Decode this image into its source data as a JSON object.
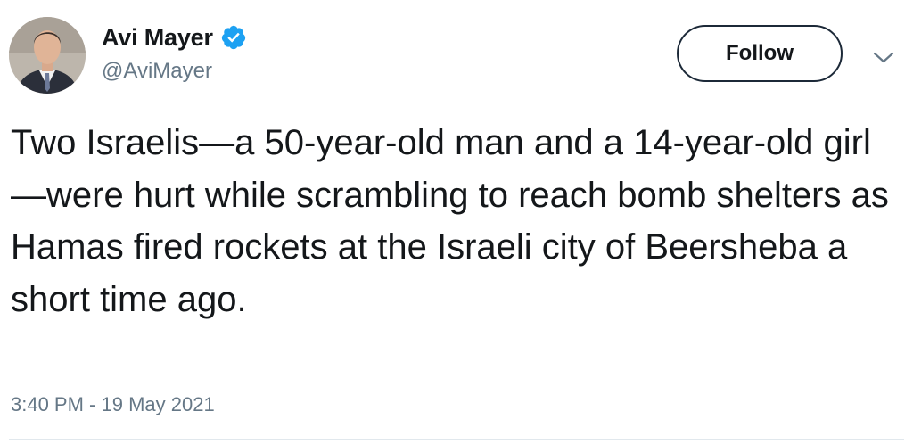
{
  "user": {
    "display_name": "Avi Mayer",
    "handle": "@AviMayer",
    "verified": true,
    "verified_icon": "verified-badge-icon"
  },
  "actions": {
    "follow_label": "Follow",
    "more_icon": "chevron-down-icon"
  },
  "tweet": {
    "text": "Two Israelis—a 50-year-old man and a 14-year-old girl—were hurt while scrambling to reach bomb shelters as Hamas fired rockets at the Israeli city of Beersheba a short time ago.",
    "timestamp": "3:40 PM - 19 May 2021"
  },
  "colors": {
    "verified_blue": "#1da1f2",
    "secondary_text": "#657786",
    "primary_text": "#14171a",
    "follow_border": "#1c2938"
  }
}
